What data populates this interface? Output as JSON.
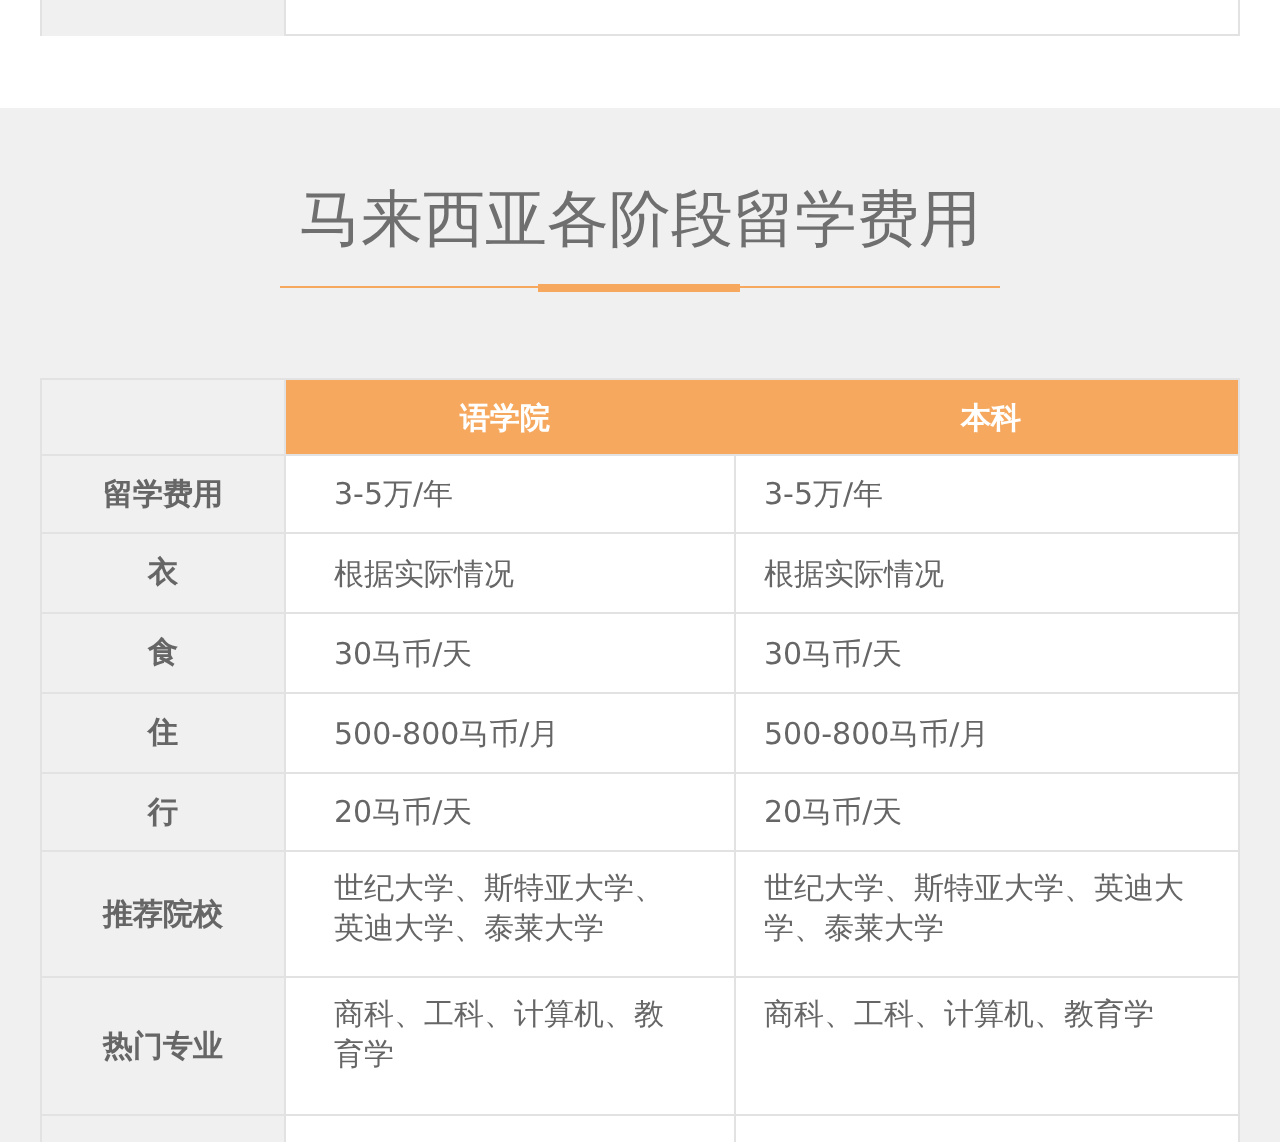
{
  "title": "马来西亚各阶段留学费用",
  "table": {
    "columns": [
      "语学院",
      "本科"
    ],
    "rows": [
      {
        "label": "留学费用",
        "cells": [
          "3-5万/年",
          "3-5万/年"
        ]
      },
      {
        "label": "衣",
        "cells": [
          "根据实际情况",
          "根据实际情况"
        ]
      },
      {
        "label": "食",
        "cells": [
          "30马币/天",
          "30马币/天"
        ]
      },
      {
        "label": "住",
        "cells": [
          "500-800马币/月",
          "500-800马币/月"
        ]
      },
      {
        "label": "行",
        "cells": [
          "20马币/天",
          "20马币/天"
        ]
      },
      {
        "label": "推荐院校",
        "cells": [
          "世纪大学、斯特亚大学、英迪大学、泰莱大学",
          "世纪大学、斯特亚大学、英迪大学、泰莱大学"
        ]
      },
      {
        "label": "热门专业",
        "cells": [
          "商科、工科、计算机、教育学",
          "商科、工科、计算机、教育学"
        ]
      }
    ]
  }
}
